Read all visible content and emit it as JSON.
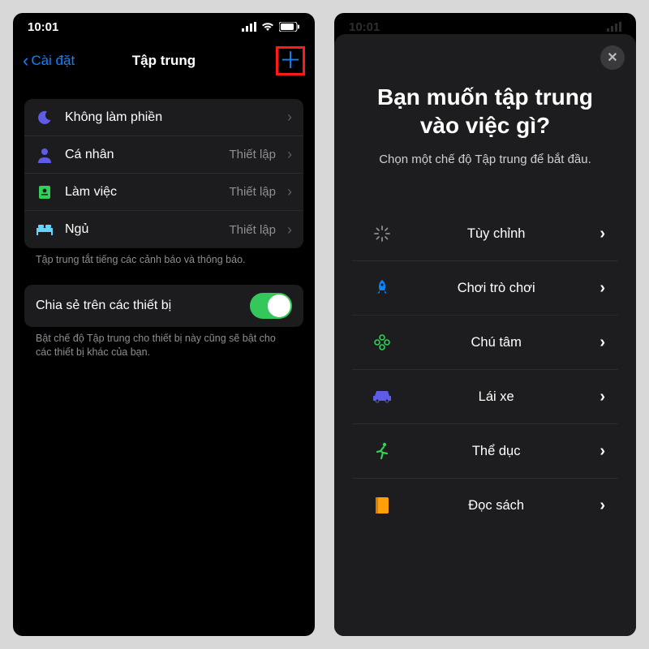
{
  "statusbar": {
    "time": "10:01"
  },
  "left": {
    "back_label": "Cài đặt",
    "title": "Tập trung",
    "rows": [
      {
        "icon": "moon",
        "label": "Không làm phiền",
        "detail": ""
      },
      {
        "icon": "person",
        "label": "Cá nhân",
        "detail": "Thiết lập"
      },
      {
        "icon": "badge",
        "label": "Làm việc",
        "detail": "Thiết lập"
      },
      {
        "icon": "bed",
        "label": "Ngủ",
        "detail": "Thiết lập"
      }
    ],
    "footnote1": "Tập trung tắt tiếng các cảnh báo và thông báo.",
    "share_label": "Chia sẻ trên các thiết bị",
    "footnote2": "Bật chế độ Tập trung cho thiết bị này cũng sẽ bật cho các thiết bị khác của bạn."
  },
  "right": {
    "heading_line1": "Bạn muốn tập trung",
    "heading_line2": "vào việc gì?",
    "subtitle": "Chọn một chế độ Tập trung để bắt đầu.",
    "options": [
      {
        "icon": "sparkle",
        "color": "#8e8e93",
        "label": "Tùy chỉnh"
      },
      {
        "icon": "rocket",
        "color": "#0a84ff",
        "label": "Chơi trò chơi"
      },
      {
        "icon": "flower",
        "color": "#30d158",
        "label": "Chú tâm"
      },
      {
        "icon": "car",
        "color": "#5e5ce6",
        "label": "Lái xe"
      },
      {
        "icon": "runner",
        "color": "#30d158",
        "label": "Thể dục"
      },
      {
        "icon": "book",
        "color": "#ff9f0a",
        "label": "Đọc sách"
      }
    ]
  }
}
